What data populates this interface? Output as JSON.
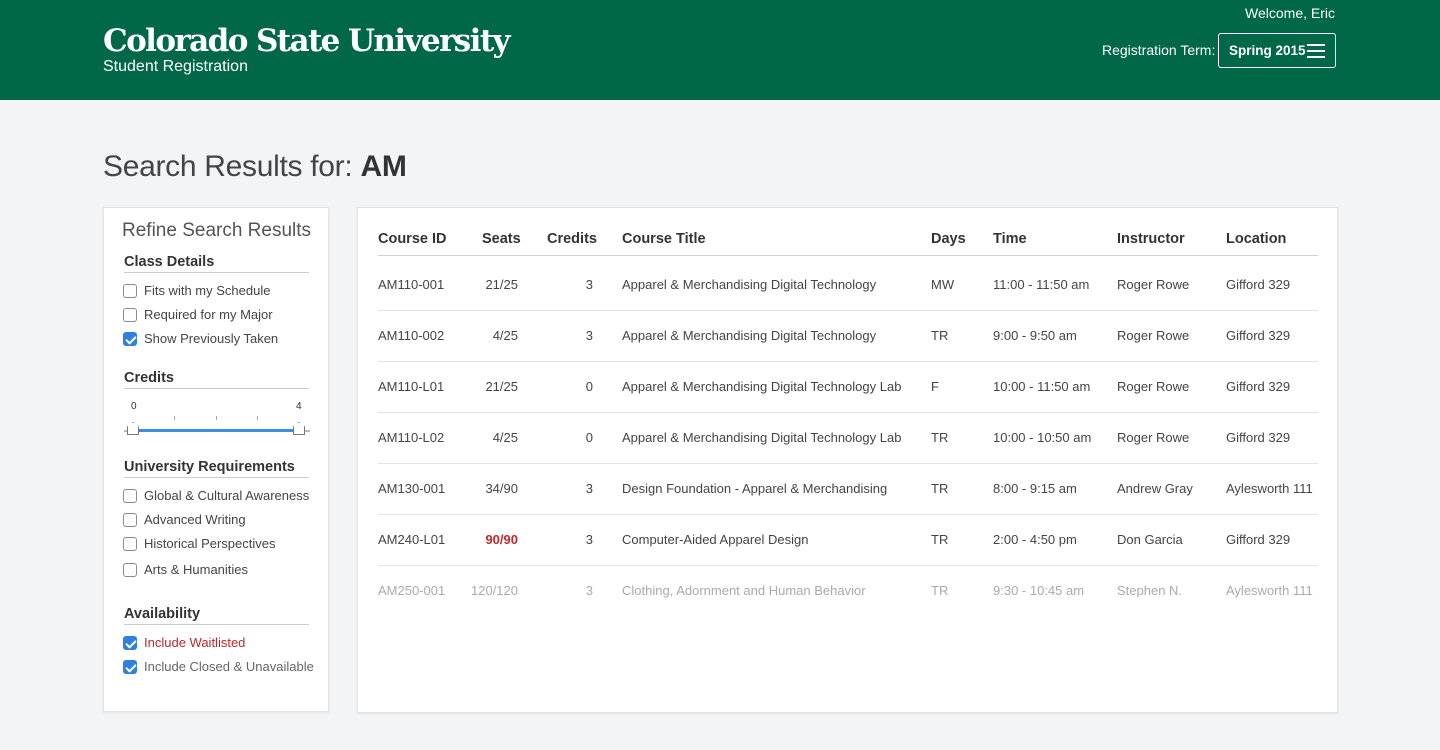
{
  "header": {
    "logo_title": "Colorado State University",
    "logo_subtitle": "Student Registration",
    "welcome": "Welcome, Eric",
    "term_label": "Registration Term:",
    "term_value": "Spring 2015"
  },
  "page": {
    "title_prefix": "Search Results for: ",
    "query": "AM"
  },
  "sidebar": {
    "title": "Refine Search Results",
    "class_details": {
      "heading": "Class Details",
      "items": [
        {
          "label": "Fits with my Schedule",
          "checked": false
        },
        {
          "label": "Required for my Major",
          "checked": false
        },
        {
          "label": "Show Previously Taken",
          "checked": true
        }
      ]
    },
    "credits": {
      "heading": "Credits",
      "min_label": "0",
      "max_label": "4",
      "range": [
        0,
        4
      ]
    },
    "university_requirements": {
      "heading": "University Requirements",
      "items": [
        {
          "label": "Global & Cultural Awareness",
          "checked": false
        },
        {
          "label": "Advanced Writing",
          "checked": false
        },
        {
          "label": "Historical Perspectives",
          "checked": false
        },
        {
          "label": "Arts & Humanities",
          "checked": false
        }
      ]
    },
    "availability": {
      "heading": "Availability",
      "items": [
        {
          "label": "Include Waitlisted",
          "checked": true
        },
        {
          "label": "Include Closed & Unavailable",
          "checked": true
        }
      ]
    }
  },
  "table": {
    "columns": [
      "Course ID",
      "Seats",
      "Credits",
      "Course Title",
      "Days",
      "Time",
      "Instructor",
      "Location"
    ],
    "rows": [
      {
        "id": "AM110-001",
        "seats": "21/25",
        "credits": "3",
        "title": "Apparel & Merchandising Digital Technology",
        "days": "MW",
        "time": "11:00 - 11:50 am",
        "instructor": "Roger Rowe",
        "location": "Gifford 329"
      },
      {
        "id": "AM110-002",
        "seats": "4/25",
        "credits": "3",
        "title": "Apparel & Merchandising Digital Technology",
        "days": "TR",
        "time": "9:00 - 9:50 am",
        "instructor": "Roger Rowe",
        "location": "Gifford 329"
      },
      {
        "id": "AM110-L01",
        "seats": "21/25",
        "credits": "0",
        "title": "Apparel & Merchandising Digital Technology Lab",
        "days": "F",
        "time": "10:00 - 11:50 am",
        "instructor": "Roger Rowe",
        "location": "Gifford 329"
      },
      {
        "id": "AM110-L02",
        "seats": "4/25",
        "credits": "0",
        "title": "Apparel & Merchandising Digital Technology Lab",
        "days": "TR",
        "time": "10:00 - 10:50 am",
        "instructor": "Roger Rowe",
        "location": "Gifford 329"
      },
      {
        "id": "AM130-001",
        "seats": "34/90",
        "credits": "3",
        "title": "Design Foundation - Apparel & Merchandising",
        "days": "TR",
        "time": "8:00 - 9:15 am",
        "instructor": "Andrew Gray",
        "location": "Aylesworth 111"
      },
      {
        "id": "AM240-L01",
        "seats": "90/90",
        "credits": "3",
        "title": "Computer-Aided Apparel Design",
        "days": "TR",
        "time": "2:00 - 4:50 pm",
        "instructor": "Don Garcia",
        "location": "Gifford 329",
        "seats_full": true
      },
      {
        "id": "AM250-001",
        "seats": "120/120",
        "credits": "3",
        "title": "Clothing, Adornment and Human Behavior",
        "days": "TR",
        "time": "9:30 - 10:45 am",
        "instructor": "Stephen N.",
        "location": "Aylesworth 111",
        "unavailable": true
      }
    ]
  },
  "colors": {
    "brand_green": "#006747",
    "checkbox_blue": "#2f80e0",
    "waitlist_red": "#c0272d"
  }
}
